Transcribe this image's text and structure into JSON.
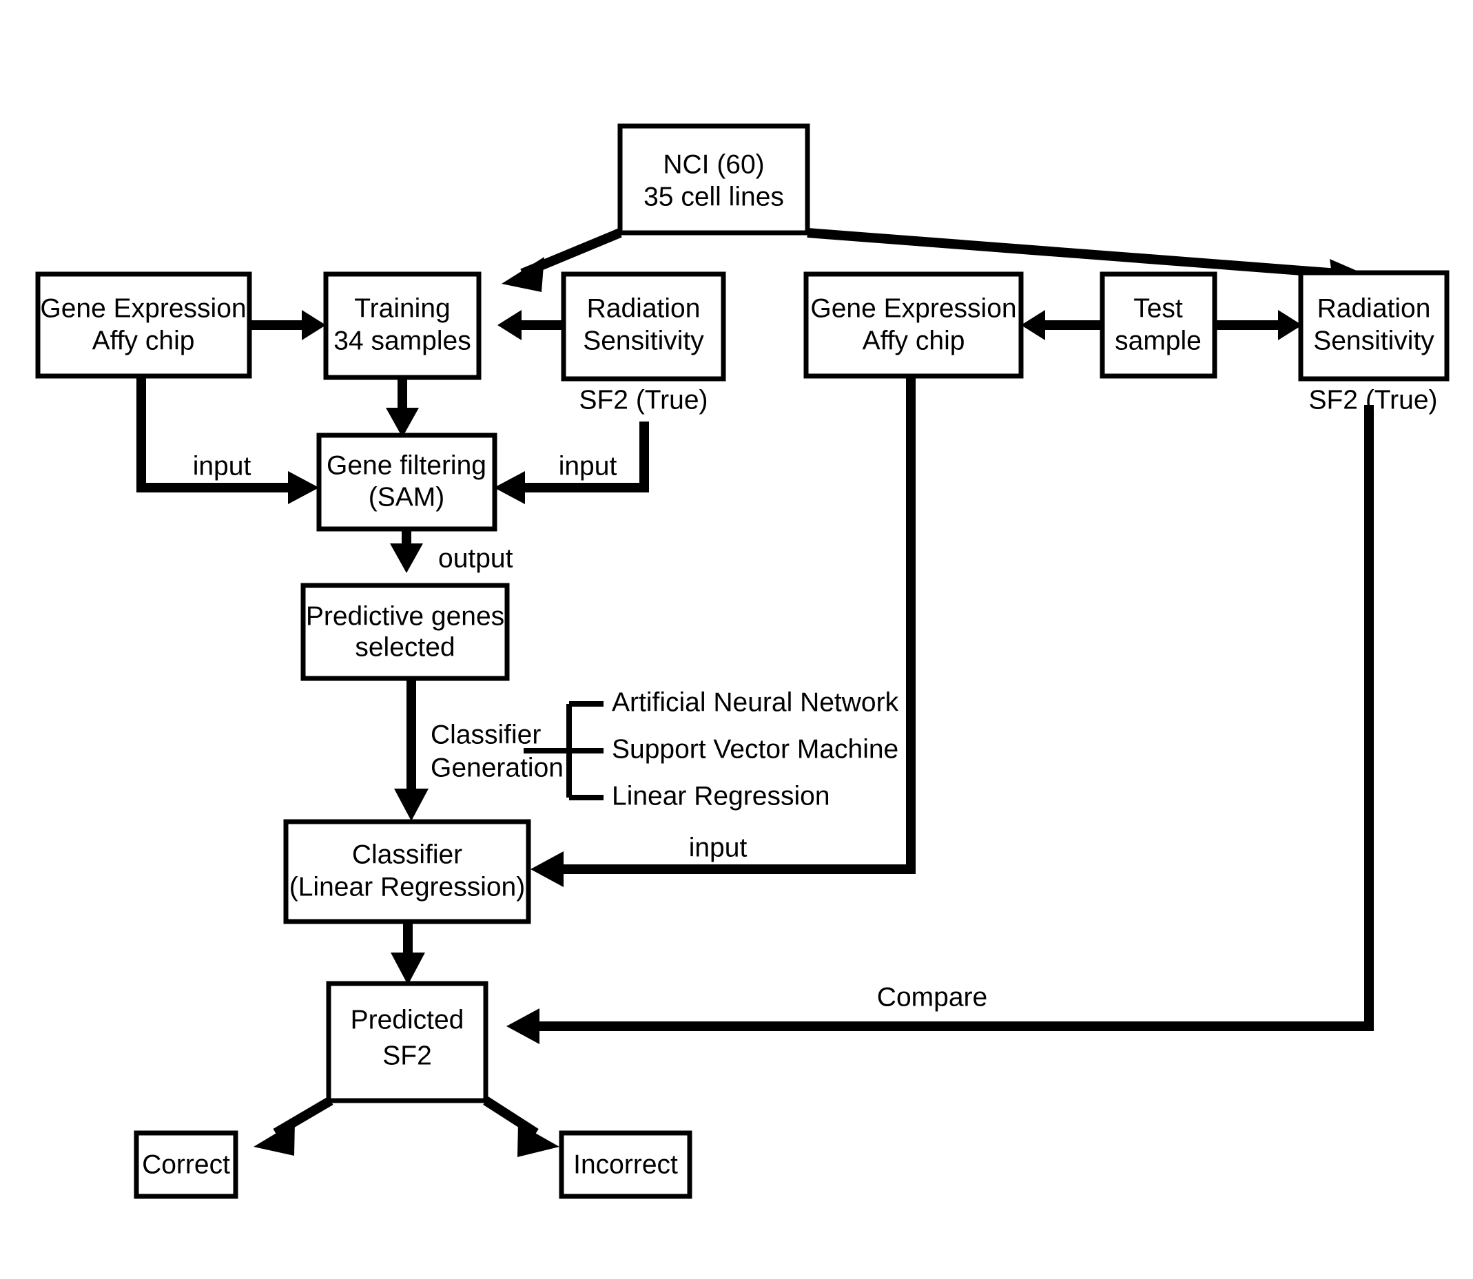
{
  "diagram": {
    "title": "Radiation sensitivity prediction workflow",
    "colors": {
      "stroke": "#000000",
      "fill": "#ffffff",
      "text": "#000000"
    },
    "boxes": {
      "nci": {
        "line1": "NCI (60)",
        "line2": "35 cell lines"
      },
      "gene_expr_train": {
        "line1": "Gene Expression",
        "line2": "Affy chip"
      },
      "training": {
        "line1": "Training",
        "line2": "34 samples"
      },
      "radiation_train": {
        "line1": "Radiation",
        "line2": "Sensitivity"
      },
      "gene_expr_test": {
        "line1": "Gene Expression",
        "line2": "Affy chip"
      },
      "test_sample": {
        "line1": "Test",
        "line2": "sample"
      },
      "radiation_test": {
        "line1": "Radiation",
        "line2": "Sensitivity"
      },
      "gene_filtering": {
        "line1": "Gene filtering",
        "line2": "(SAM)"
      },
      "predictive_genes": {
        "line1": "Predictive genes",
        "line2": "selected"
      },
      "classifier": {
        "line1": "Classifier",
        "line2": "(Linear Regression)"
      },
      "predicted_sf2": {
        "line1": "Predicted",
        "line2": "SF2"
      },
      "correct": {
        "line1": "Correct"
      },
      "incorrect": {
        "line1": "Incorrect"
      }
    },
    "labels": {
      "sf2_true_left": "SF2 (True)",
      "sf2_true_right": "SF2 (True)",
      "input_left": "input",
      "input_right": "input",
      "output": "output",
      "input_test": "input",
      "compare": "Compare",
      "classifier_generation_line1": "Classifier",
      "classifier_generation_line2": "Generation"
    },
    "classifier_methods": [
      "Artificial Neural Network",
      "Support Vector Machine",
      "Linear Regression"
    ]
  }
}
